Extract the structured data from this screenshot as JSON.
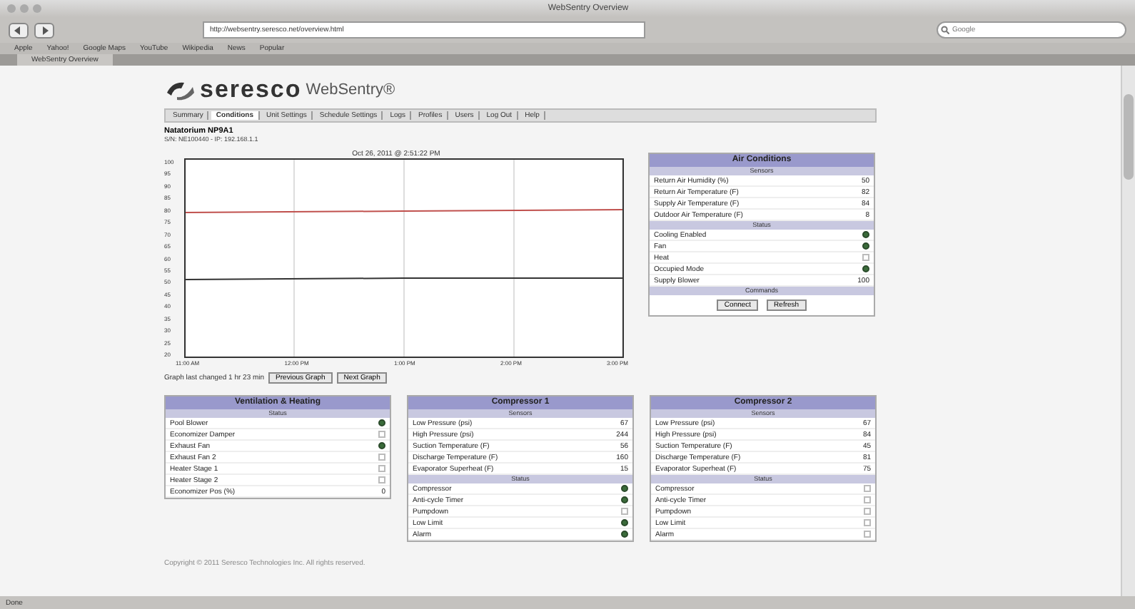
{
  "browser": {
    "window_title": "WebSentry Overview",
    "url": "http://websentry.seresco.net/overview.html",
    "search_placeholder": "Google",
    "bookmarks": [
      "Apple",
      "Yahoo!",
      "Google Maps",
      "YouTube",
      "Wikipedia",
      "News",
      "Popular"
    ],
    "tabs": [
      {
        "label": "WebSentry Overview",
        "selected": true
      }
    ],
    "status_text": "Done"
  },
  "page": {
    "brand": "seresco",
    "product": "WebSentry®",
    "nav": [
      {
        "label": "Summary",
        "selected": false
      },
      {
        "label": "Conditions",
        "selected": true
      },
      {
        "label": "Unit Settings",
        "selected": false
      },
      {
        "label": "Schedule Settings",
        "selected": false
      },
      {
        "label": "Logs",
        "selected": false
      },
      {
        "label": "Profiles",
        "selected": false
      },
      {
        "label": "Users",
        "selected": false
      },
      {
        "label": "Log Out",
        "selected": false
      },
      {
        "label": "Help",
        "selected": false
      }
    ],
    "unit_name": "Natatorium NP9A1",
    "unit_info": "S/N: NE100440 - IP: 192.168.1.1",
    "chart": {
      "title": "Oct 26, 2011 @ 2:51:22 PM",
      "y_ticks": [
        "100",
        "95",
        "90",
        "85",
        "80",
        "75",
        "70",
        "65",
        "60",
        "55",
        "50",
        "45",
        "40",
        "35",
        "30",
        "25",
        "20"
      ],
      "x_ticks": [
        "11:00 AM",
        "12:00 PM",
        "1:00 PM",
        "2:00 PM",
        "3:00 PM"
      ],
      "caption": "Graph last changed 1 hr 23 min",
      "buttons": [
        "Previous Graph",
        "Next Graph"
      ]
    },
    "panels": [
      {
        "title": "Air Conditions",
        "sections": [
          {
            "title": "Sensors",
            "rows": [
              {
                "kind": "value",
                "label": "Return Air Humidity (%)",
                "value": "50"
              },
              {
                "kind": "value",
                "label": "Return Air Temperature (F)",
                "value": "82"
              },
              {
                "kind": "value",
                "label": "Supply Air Temperature (F)",
                "value": "84"
              },
              {
                "kind": "value",
                "label": "Outdoor Air Temperature (F)",
                "value": "8"
              }
            ]
          },
          {
            "title": "Status",
            "rows": [
              {
                "kind": "indicator",
                "label": "Cooling Enabled",
                "on": true
              },
              {
                "kind": "indicator",
                "label": "Fan",
                "on": true
              },
              {
                "kind": "indicator",
                "label": "Heat",
                "on": false
              },
              {
                "kind": "indicator",
                "label": "Occupied Mode",
                "on": true
              },
              {
                "kind": "value",
                "label": "Supply Blower",
                "value": "100"
              }
            ]
          },
          {
            "title": "Commands",
            "buttons": [
              "Connect",
              "Refresh"
            ]
          }
        ]
      },
      {
        "title": "Ventilation & Heating",
        "sections": [
          {
            "title": "Status",
            "rows": [
              {
                "kind": "indicator",
                "label": "Pool Blower",
                "on": true
              },
              {
                "kind": "indicator",
                "label": "Economizer Damper",
                "on": false
              },
              {
                "kind": "indicator",
                "label": "Exhaust Fan",
                "on": true
              },
              {
                "kind": "indicator",
                "label": "Exhaust Fan 2",
                "on": false
              },
              {
                "kind": "indicator",
                "label": "Heater Stage 1",
                "on": false
              },
              {
                "kind": "indicator",
                "label": "Heater Stage 2",
                "on": false
              },
              {
                "kind": "value",
                "label": "Economizer Pos (%)",
                "value": "0"
              }
            ]
          }
        ]
      },
      {
        "title": "Compressor 1",
        "sections": [
          {
            "title": "Sensors",
            "rows": [
              {
                "kind": "value",
                "label": "Low Pressure (psi)",
                "value": "67"
              },
              {
                "kind": "value",
                "label": "High Pressure (psi)",
                "value": "244"
              },
              {
                "kind": "value",
                "label": "Suction Temperature (F)",
                "value": "56"
              },
              {
                "kind": "value",
                "label": "Discharge Temperature (F)",
                "value": "160"
              },
              {
                "kind": "value",
                "label": "Evaporator Superheat (F)",
                "value": "15"
              }
            ]
          },
          {
            "title": "Status",
            "rows": [
              {
                "kind": "indicator",
                "label": "Compressor",
                "on": true
              },
              {
                "kind": "indicator",
                "label": "Anti-cycle Timer",
                "on": true
              },
              {
                "kind": "indicator",
                "label": "Pumpdown",
                "on": false
              },
              {
                "kind": "indicator",
                "label": "Low Limit",
                "on": true
              },
              {
                "kind": "indicator",
                "label": "Alarm",
                "on": true
              }
            ]
          }
        ]
      },
      {
        "title": "Compressor 2",
        "sections": [
          {
            "title": "Sensors",
            "rows": [
              {
                "kind": "value",
                "label": "Low Pressure (psi)",
                "value": "67"
              },
              {
                "kind": "value",
                "label": "High Pressure (psi)",
                "value": "84"
              },
              {
                "kind": "value",
                "label": "Suction Temperature (F)",
                "value": "45"
              },
              {
                "kind": "value",
                "label": "Discharge Temperature (F)",
                "value": "81"
              },
              {
                "kind": "value",
                "label": "Evaporator Superheat (F)",
                "value": "75"
              }
            ]
          },
          {
            "title": "Status",
            "rows": [
              {
                "kind": "indicator",
                "label": "Compressor",
                "on": false
              },
              {
                "kind": "indicator",
                "label": "Anti-cycle Timer",
                "on": false
              },
              {
                "kind": "indicator",
                "label": "Pumpdown",
                "on": false
              },
              {
                "kind": "indicator",
                "label": "Low Limit",
                "on": false
              },
              {
                "kind": "indicator",
                "label": "Alarm",
                "on": false
              }
            ]
          }
        ]
      }
    ],
    "footer": "Copyright © 2011 Seresco Technologies Inc. All rights reserved."
  }
}
